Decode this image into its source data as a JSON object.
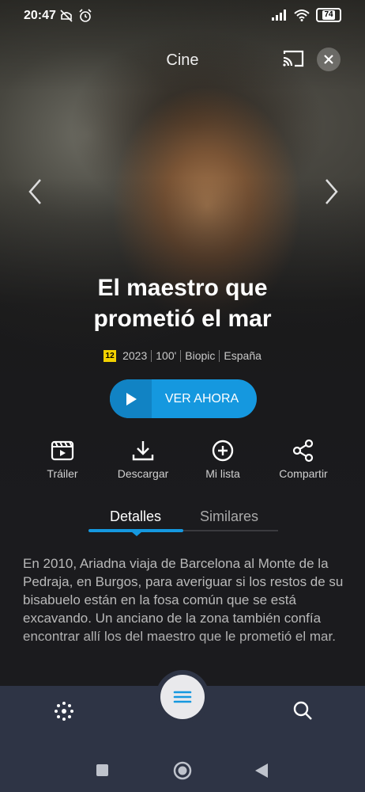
{
  "status_bar": {
    "time": "20:47",
    "battery": "74"
  },
  "header": {
    "title": "Cine"
  },
  "movie": {
    "title_line1": "El maestro que",
    "title_line2": "prometió el mar",
    "age_rating": "12",
    "year": "2023",
    "duration": "100'",
    "genre": "Biopic",
    "country": "España"
  },
  "watch_button": {
    "label": "VER AHORA"
  },
  "actions": {
    "trailer": "Tráiler",
    "download": "Descargar",
    "my_list": "Mi lista",
    "share": "Compartir"
  },
  "tabs": {
    "details": "Detalles",
    "similar": "Similares",
    "active": "Detalles"
  },
  "description": "En 2010, Ariadna viaja de Barcelona al Monte de la Pedraja, en Burgos, para averiguar si los restos de su bisabuelo están en la fosa común que se está excavando. Un anciano de la zona también confía encontrar allí los del maestro que le prometió el mar.",
  "colors": {
    "accent": "#1598df",
    "nav_bg": "#2e3445",
    "age_badge": "#f2d100"
  },
  "icons": [
    "cast-icon",
    "close-icon",
    "chevron-left-icon",
    "chevron-right-icon",
    "play-icon",
    "film-icon",
    "download-icon",
    "add-circle-icon",
    "share-icon",
    "home-dots-icon",
    "menu-icon",
    "search-icon"
  ]
}
